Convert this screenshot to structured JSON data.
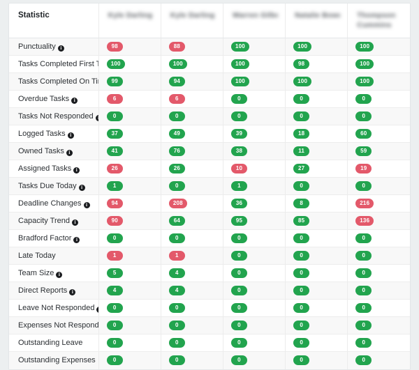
{
  "table": {
    "statistic_column_header": "Statistic",
    "columns": [
      {
        "name": "person-column-1",
        "redacted": true,
        "lines": [
          "Kyle Darling Q"
        ]
      },
      {
        "name": "person-column-2",
        "redacted": true,
        "lines": [
          "Kyle Darling"
        ]
      },
      {
        "name": "person-column-3",
        "redacted": true,
        "lines": [
          "Warren Gilbert"
        ]
      },
      {
        "name": "person-column-4",
        "redacted": true,
        "lines": [
          "Natalie Bower"
        ]
      },
      {
        "name": "person-column-5",
        "redacted": true,
        "lines": [
          "Thompson",
          "Cummins"
        ]
      }
    ],
    "rows": [
      {
        "label": "Punctuality",
        "has_info": true,
        "values": [
          {
            "text": "98",
            "status": "bad"
          },
          {
            "text": "88",
            "status": "bad"
          },
          {
            "text": "100",
            "status": "good"
          },
          {
            "text": "100",
            "status": "good"
          },
          {
            "text": "100",
            "status": "good"
          }
        ]
      },
      {
        "label": "Tasks Completed First Time",
        "has_info": true,
        "values": [
          {
            "text": "100",
            "status": "good"
          },
          {
            "text": "100",
            "status": "good"
          },
          {
            "text": "100",
            "status": "good"
          },
          {
            "text": "98",
            "status": "good"
          },
          {
            "text": "100",
            "status": "good"
          }
        ]
      },
      {
        "label": "Tasks Completed On Time",
        "has_info": true,
        "values": [
          {
            "text": "99",
            "status": "good"
          },
          {
            "text": "94",
            "status": "good"
          },
          {
            "text": "100",
            "status": "good"
          },
          {
            "text": "100",
            "status": "good"
          },
          {
            "text": "100",
            "status": "good"
          }
        ]
      },
      {
        "label": "Overdue Tasks",
        "has_info": true,
        "values": [
          {
            "text": "6",
            "status": "bad"
          },
          {
            "text": "6",
            "status": "bad"
          },
          {
            "text": "0",
            "status": "good"
          },
          {
            "text": "0",
            "status": "good"
          },
          {
            "text": "0",
            "status": "good"
          }
        ]
      },
      {
        "label": "Tasks Not Responded",
        "has_info": true,
        "values": [
          {
            "text": "0",
            "status": "good"
          },
          {
            "text": "0",
            "status": "good"
          },
          {
            "text": "0",
            "status": "good"
          },
          {
            "text": "0",
            "status": "good"
          },
          {
            "text": "0",
            "status": "good"
          }
        ]
      },
      {
        "label": "Logged Tasks",
        "has_info": true,
        "values": [
          {
            "text": "37",
            "status": "good"
          },
          {
            "text": "49",
            "status": "good"
          },
          {
            "text": "39",
            "status": "good"
          },
          {
            "text": "18",
            "status": "good"
          },
          {
            "text": "60",
            "status": "good"
          }
        ]
      },
      {
        "label": "Owned Tasks",
        "has_info": true,
        "values": [
          {
            "text": "41",
            "status": "good"
          },
          {
            "text": "76",
            "status": "good"
          },
          {
            "text": "38",
            "status": "good"
          },
          {
            "text": "11",
            "status": "good"
          },
          {
            "text": "59",
            "status": "good"
          }
        ]
      },
      {
        "label": "Assigned Tasks",
        "has_info": true,
        "values": [
          {
            "text": "26",
            "status": "bad"
          },
          {
            "text": "26",
            "status": "good"
          },
          {
            "text": "10",
            "status": "bad"
          },
          {
            "text": "27",
            "status": "good"
          },
          {
            "text": "19",
            "status": "bad"
          }
        ]
      },
      {
        "label": "Tasks Due Today",
        "has_info": true,
        "values": [
          {
            "text": "1",
            "status": "good"
          },
          {
            "text": "0",
            "status": "good"
          },
          {
            "text": "1",
            "status": "good"
          },
          {
            "text": "0",
            "status": "good"
          },
          {
            "text": "0",
            "status": "good"
          }
        ]
      },
      {
        "label": "Deadline Changes",
        "has_info": true,
        "values": [
          {
            "text": "94",
            "status": "bad"
          },
          {
            "text": "208",
            "status": "bad"
          },
          {
            "text": "36",
            "status": "good"
          },
          {
            "text": "8",
            "status": "good"
          },
          {
            "text": "216",
            "status": "bad"
          }
        ]
      },
      {
        "label": "Capacity Trend",
        "has_info": true,
        "values": [
          {
            "text": "90",
            "status": "bad"
          },
          {
            "text": "64",
            "status": "good"
          },
          {
            "text": "95",
            "status": "good"
          },
          {
            "text": "85",
            "status": "good"
          },
          {
            "text": "136",
            "status": "bad"
          }
        ]
      },
      {
        "label": "Bradford Factor",
        "has_info": true,
        "values": [
          {
            "text": "0",
            "status": "good"
          },
          {
            "text": "0",
            "status": "good"
          },
          {
            "text": "0",
            "status": "good"
          },
          {
            "text": "0",
            "status": "good"
          },
          {
            "text": "0",
            "status": "good"
          }
        ]
      },
      {
        "label": "Late Today",
        "has_info": false,
        "values": [
          {
            "text": "1",
            "status": "bad"
          },
          {
            "text": "1",
            "status": "bad"
          },
          {
            "text": "0",
            "status": "good"
          },
          {
            "text": "0",
            "status": "good"
          },
          {
            "text": "0",
            "status": "good"
          }
        ]
      },
      {
        "label": "Team Size",
        "has_info": true,
        "values": [
          {
            "text": "5",
            "status": "good"
          },
          {
            "text": "4",
            "status": "good"
          },
          {
            "text": "0",
            "status": "good"
          },
          {
            "text": "0",
            "status": "good"
          },
          {
            "text": "0",
            "status": "good"
          }
        ]
      },
      {
        "label": "Direct Reports",
        "has_info": true,
        "values": [
          {
            "text": "4",
            "status": "good"
          },
          {
            "text": "4",
            "status": "good"
          },
          {
            "text": "0",
            "status": "good"
          },
          {
            "text": "0",
            "status": "good"
          },
          {
            "text": "0",
            "status": "good"
          }
        ]
      },
      {
        "label": "Leave Not Responded",
        "has_info": true,
        "values": [
          {
            "text": "0",
            "status": "good"
          },
          {
            "text": "0",
            "status": "good"
          },
          {
            "text": "0",
            "status": "good"
          },
          {
            "text": "0",
            "status": "good"
          },
          {
            "text": "0",
            "status": "good"
          }
        ]
      },
      {
        "label": "Expenses Not Responded",
        "has_info": true,
        "values": [
          {
            "text": "0",
            "status": "good"
          },
          {
            "text": "0",
            "status": "good"
          },
          {
            "text": "0",
            "status": "good"
          },
          {
            "text": "0",
            "status": "good"
          },
          {
            "text": "0",
            "status": "good"
          }
        ]
      },
      {
        "label": "Outstanding Leave",
        "has_info": false,
        "values": [
          {
            "text": "0",
            "status": "good"
          },
          {
            "text": "0",
            "status": "good"
          },
          {
            "text": "0",
            "status": "good"
          },
          {
            "text": "0",
            "status": "good"
          },
          {
            "text": "0",
            "status": "good"
          }
        ]
      },
      {
        "label": "Outstanding Expenses",
        "has_info": false,
        "values": [
          {
            "text": "0",
            "status": "good"
          },
          {
            "text": "0",
            "status": "good"
          },
          {
            "text": "0",
            "status": "good"
          },
          {
            "text": "0",
            "status": "good"
          },
          {
            "text": "0",
            "status": "good"
          }
        ]
      }
    ]
  },
  "icons": {
    "info": "i"
  },
  "colors": {
    "badge_good": "#22a44e",
    "badge_bad": "#e3596a",
    "page_background": "#eceff0",
    "card_background": "#ffffff",
    "row_stripe": "#f8f8f8",
    "border": "#e3e6e8",
    "text": "#2b2f33"
  }
}
